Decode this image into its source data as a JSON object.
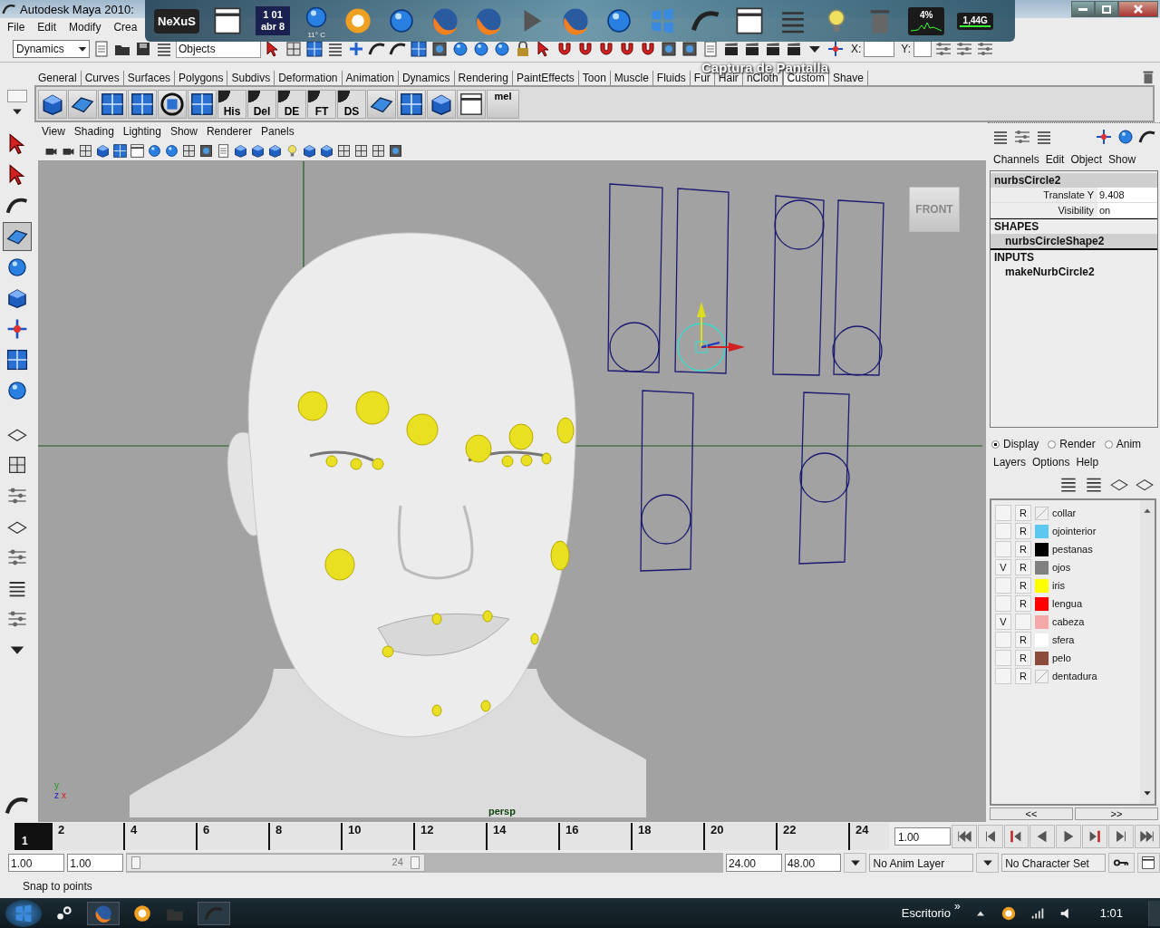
{
  "window": {
    "title": "Autodesk Maya 2010:"
  },
  "dock": {
    "logo": "NeXuS",
    "clock": [
      "1 01",
      "abr 8"
    ],
    "weather": "11° C",
    "cpu": "4%",
    "memory": "1,44G",
    "caption": "Captura de Pantalla"
  },
  "menu_bar": [
    "File",
    "Edit",
    "Modify",
    "Crea"
  ],
  "status_line": {
    "menu_set": "Dynamics",
    "selection_field": "Objects",
    "x_label": "X:",
    "y_label": "Y:"
  },
  "shelf": {
    "tabs": [
      {
        "label": "General",
        "selected": false
      },
      {
        "label": "Curves",
        "selected": false
      },
      {
        "label": "Surfaces",
        "selected": false
      },
      {
        "label": "Polygons",
        "selected": false
      },
      {
        "label": "Subdivs",
        "selected": false
      },
      {
        "label": "Deformation",
        "selected": false
      },
      {
        "label": "Animation",
        "selected": false
      },
      {
        "label": "Dynamics",
        "selected": false
      },
      {
        "label": "Rendering",
        "selected": false
      },
      {
        "label": "PaintEffects",
        "selected": false
      },
      {
        "label": "Toon",
        "selected": false
      },
      {
        "label": "Muscle",
        "selected": false
      },
      {
        "label": "Fluids",
        "selected": false
      },
      {
        "label": "Fur",
        "selected": false
      },
      {
        "label": "Hair",
        "selected": false
      },
      {
        "label": "nCloth",
        "selected": false
      },
      {
        "label": "Custom",
        "selected": true
      },
      {
        "label": "Shave",
        "selected": false
      }
    ],
    "buttons": [
      "His",
      "Del",
      "DE",
      "FT",
      "DS",
      "mel"
    ]
  },
  "viewport": {
    "menus": [
      "View",
      "Shading",
      "Lighting",
      "Show",
      "Renderer",
      "Panels"
    ],
    "view_cube": "FRONT",
    "camera": "persp",
    "axes": [
      "y",
      "z",
      "x"
    ]
  },
  "channel_box": {
    "menus": [
      "Channels",
      "Edit",
      "Object",
      "Show"
    ],
    "object": "nurbsCircle2",
    "attributes": [
      {
        "name": "Translate Y",
        "value": "9.408"
      },
      {
        "name": "Visibility",
        "value": "on"
      }
    ],
    "shapes_heading": "SHAPES",
    "shapes": [
      "nurbsCircleShape2"
    ],
    "inputs_heading": "INPUTS",
    "inputs": [
      "makeNurbCircle2"
    ]
  },
  "layer_editor": {
    "modes": [
      {
        "label": "Display",
        "selected": true
      },
      {
        "label": "Render",
        "selected": false
      },
      {
        "label": "Anim",
        "selected": false
      }
    ],
    "menus": [
      "Layers",
      "Options",
      "Help"
    ],
    "layers": [
      {
        "name": "collar",
        "mode": "R"
      },
      {
        "name": "ojointerior",
        "mode": "R",
        "color": "#5bc8f0"
      },
      {
        "name": "pestanas",
        "mode": "R",
        "color": "#000000"
      },
      {
        "name": "ojos",
        "visibility": "V",
        "mode": "R",
        "color": "#808080"
      },
      {
        "name": "iris",
        "mode": "R",
        "color": "#ffff00"
      },
      {
        "name": "lengua",
        "mode": "R",
        "color": "#ff0000"
      },
      {
        "name": "cabeza",
        "visibility": "V",
        "color": "#f4a8a8"
      },
      {
        "name": "sfera",
        "mode": "R",
        "color": "#ffffff"
      },
      {
        "name": "pelo",
        "mode": "R",
        "color": "#8b4a3a"
      },
      {
        "name": "dentadura",
        "mode": "R"
      }
    ],
    "scroll_buttons": [
      "<<",
      ">>"
    ]
  },
  "timeline": {
    "level": 0,
    "current_frame": "1",
    "ticks": [
      "2",
      "4",
      "6",
      "8",
      "10",
      "12",
      "14",
      "16",
      "18",
      "20",
      "22",
      "24"
    ],
    "current_time": "1.00"
  },
  "range_slider": {
    "start_min": "1.00",
    "start": "1.00",
    "level": 0.5,
    "slider_label": "24",
    "end": "24.00",
    "end_max": "48.00",
    "anim_layer": "No Anim Layer",
    "character_set": "No Character Set"
  },
  "help_line": "Snap to points",
  "taskbar": {
    "toolbar": "Escritorio",
    "more": "»",
    "clock": "1:01"
  }
}
